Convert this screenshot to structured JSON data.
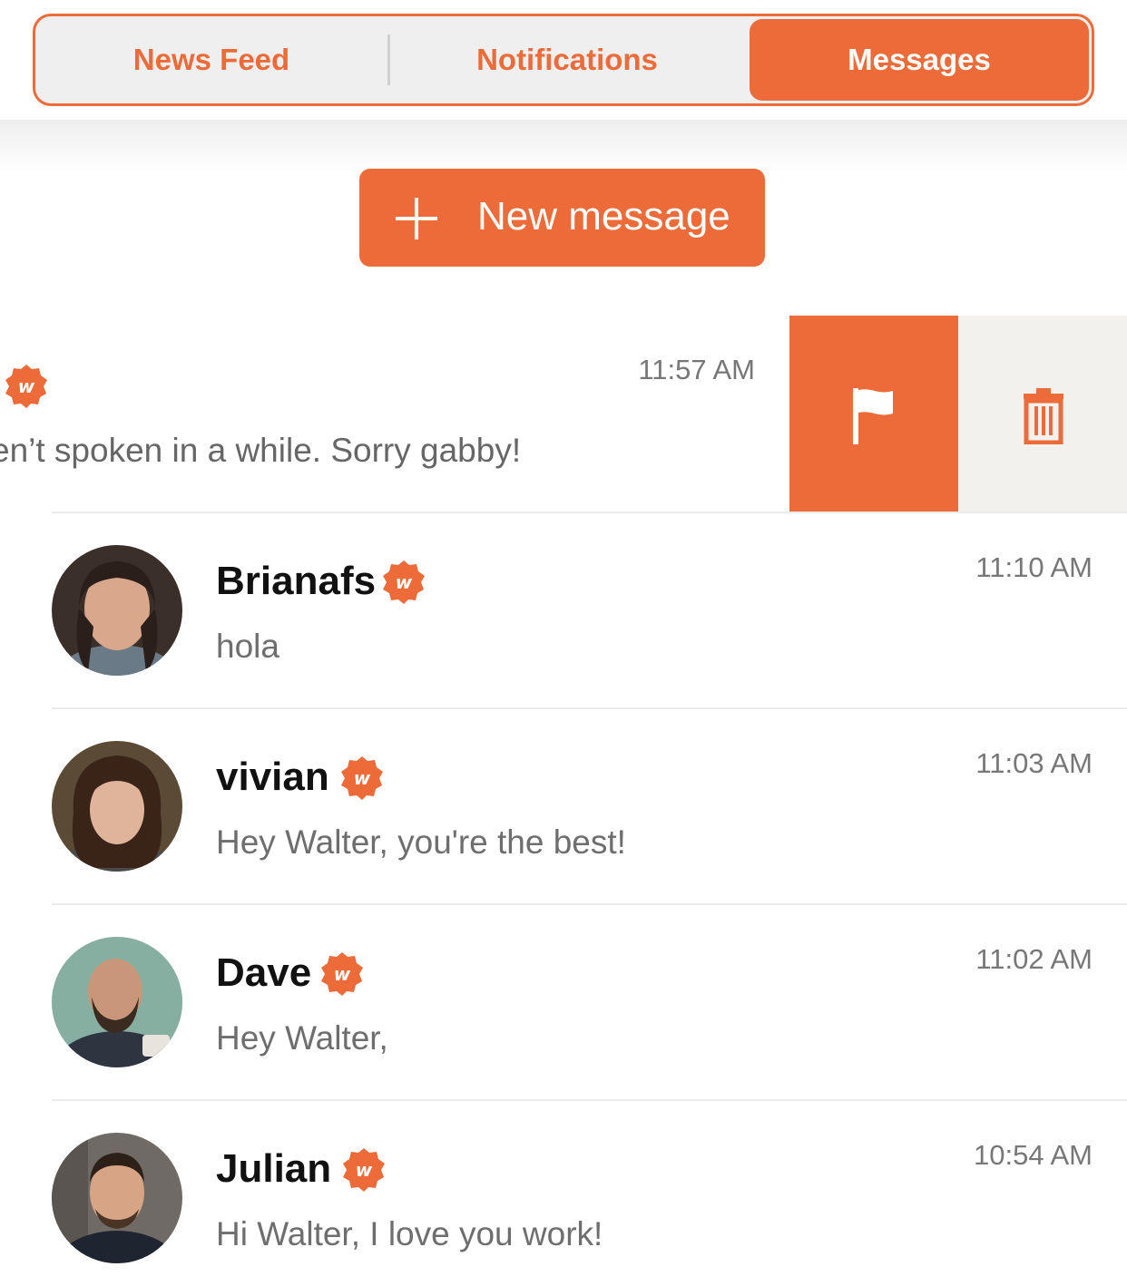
{
  "tabs": [
    {
      "label": "News Feed",
      "active": false
    },
    {
      "label": "Notifications",
      "active": false
    },
    {
      "label": "Messages",
      "active": true
    }
  ],
  "new_message_button": {
    "label": "New message",
    "icon": "plus-icon"
  },
  "swiped_conversation": {
    "time": "11:57 AM",
    "preview": "en’t spoken in a while. Sorry gabby!",
    "actions": [
      {
        "name": "flag",
        "icon": "flag-icon",
        "color": "#ec6b38"
      },
      {
        "name": "delete",
        "icon": "trash-icon",
        "color": "#f2f1ee"
      }
    ]
  },
  "conversations": [
    {
      "name": "Brianafs",
      "preview": "hola",
      "time": "11:10 AM"
    },
    {
      "name": "vivian",
      "preview": "Hey Walter, you're the best!",
      "time": "11:03 AM"
    },
    {
      "name": "Dave",
      "preview": "Hey Walter,",
      "time": "11:02 AM"
    },
    {
      "name": "Julian",
      "preview": "Hi Walter, I love you work!",
      "time": "10:54 AM"
    }
  ],
  "colors": {
    "accent": "#ec6b38",
    "segment_bg": "#efefef",
    "muted_text": "#6e6e6e"
  }
}
